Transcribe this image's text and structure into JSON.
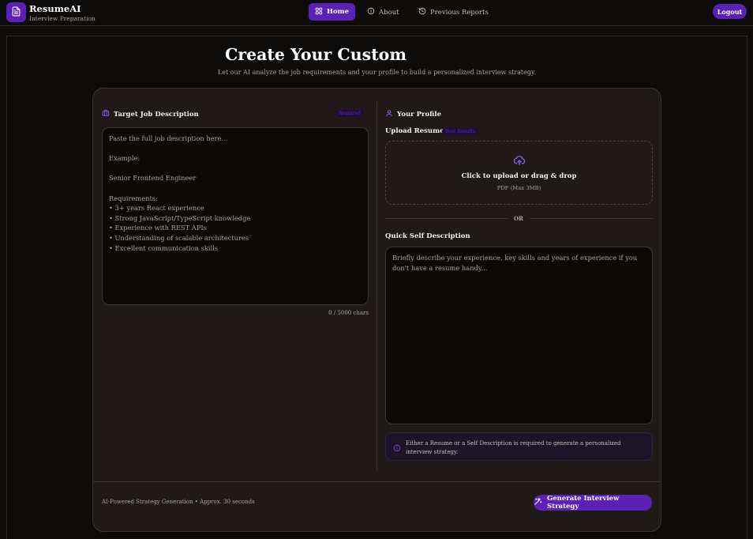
{
  "brand": {
    "name": "ResumeAI",
    "subtitle": "Interview Preparation"
  },
  "nav": {
    "home": "Home",
    "about": "About",
    "reports": "Previous Reports",
    "logout": "Logout"
  },
  "hero": {
    "title": "Create Your Custom",
    "subtitle": "Let our AI analyze the job requirements and your profile to build a personalized interview strategy."
  },
  "job": {
    "heading": "Target Job Description",
    "badge": "Required",
    "placeholder": "Paste the full job description here...\n\nExample:\n\nSenior Frontend Engineer\n\nRequirements:\n• 3+ years React experience\n• Strong JavaScript/TypeScript knowledge\n• Experience with REST APIs\n• Understanding of scalable architectures\n• Excellent communication skills",
    "char_count": "0 / 5000 chars"
  },
  "profile": {
    "heading": "Your Profile",
    "upload_label": "Upload Resume",
    "upload_badge": "Best Results",
    "upload_title": "Click to upload or drag & drop",
    "upload_sub": "PDF (Max 3MB)",
    "or": "OR",
    "self_label": "Quick Self Description",
    "self_placeholder": "Briefly describe your experience, key skills and years of experience if you don't have a resume handy...",
    "notice": "Either a Resume or a Self Description is required to generate a personalized interview strategy."
  },
  "footer": {
    "info": "AI-Powered Strategy Generation • Approx. 30 seconds",
    "button": "Generate Interview Strategy"
  },
  "colors": {
    "accent": "#5b21b6",
    "background": "#0d0b0a",
    "card": "#1f1a18"
  },
  "icons": [
    "document-icon",
    "grid-icon",
    "info-icon",
    "history-icon",
    "briefcase-icon",
    "user-icon",
    "upload-cloud-icon",
    "sparkles-icon"
  ]
}
